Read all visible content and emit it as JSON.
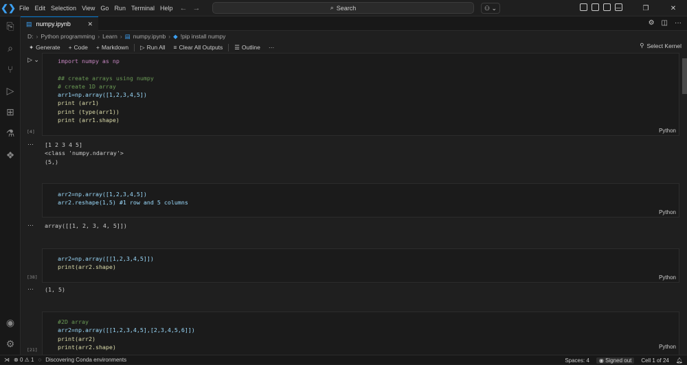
{
  "menu": [
    "File",
    "Edit",
    "Selection",
    "View",
    "Go",
    "Run",
    "Terminal",
    "Help"
  ],
  "search": {
    "placeholder": "Search"
  },
  "tab": {
    "title": "numpy.ipynb"
  },
  "breadcrumb": [
    "D:",
    "Python programming",
    "Learn",
    "numpy.ipynb",
    "!pip install numpy"
  ],
  "toolbar": {
    "generate": "Generate",
    "code": "Code",
    "markdown": "Markdown",
    "run_all": "Run All",
    "clear_outputs": "Clear All Outputs",
    "outline": "Outline",
    "more": "···",
    "select_kernel": "Select Kernel"
  },
  "cells": [
    {
      "count": "[4]",
      "language": "Python",
      "output": "[1 2 3 4 5]\n<class 'numpy.ndarray'>\n(5,)"
    },
    {
      "count": "",
      "language": "Python",
      "output": "array([[1, 2, 3, 4, 5]])"
    },
    {
      "count": "[38]",
      "language": "Python",
      "output": "(1, 5)"
    },
    {
      "count": "[21]",
      "language": "Python"
    }
  ],
  "code_lines": {
    "c1": [
      "import numpy as np",
      "",
      "## create arrays using numpy",
      "# create 1D array",
      "arr1=np.array([1,2,3,4,5])",
      "print (arr1)",
      "print (type(arr1))",
      "print (arr1.shape)"
    ],
    "c2": [
      "arr2=np.array([1,2,3,4,5])",
      "arr2.reshape(1,5) #1 row and 5 columns"
    ],
    "c3": [
      "arr2=np.array([[1,2,3,4,5]])",
      "print(arr2.shape)"
    ],
    "c4": [
      "#2D array",
      "arr2=np.array([[1,2,3,4,5],[2,3,4,5,6]])",
      "print(arr2)",
      "print(arr2.shape)"
    ]
  },
  "status": {
    "errors": "0",
    "warnings": "1",
    "message": "Discovering Conda environments",
    "spaces": "Spaces: 4",
    "account": "Signed out",
    "cell": "Cell 1 of 24"
  },
  "colors": {
    "accent": "#0078d4",
    "keyword": "#c586c0",
    "function": "#dcdcaa",
    "comment": "#6a9955",
    "builtin": "#4ec9b0"
  }
}
